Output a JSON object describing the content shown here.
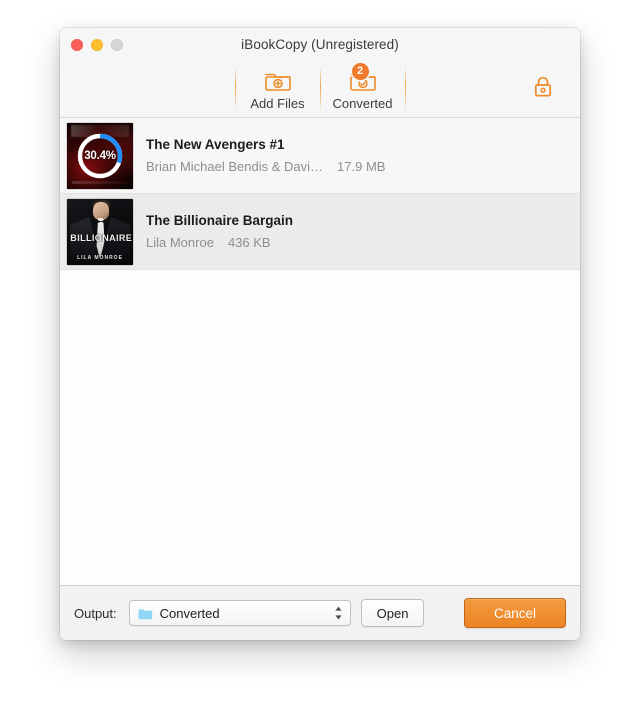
{
  "window": {
    "title": "iBookCopy (Unregistered)",
    "traffic_lights": [
      {
        "name": "close",
        "color": "#fb5f57"
      },
      {
        "name": "minimize",
        "color": "#fbbe2e"
      },
      {
        "name": "zoom",
        "color": "#d4d4d4"
      }
    ]
  },
  "toolbar": {
    "add_files_label": "Add Files",
    "converted_label": "Converted",
    "converted_badge": "2",
    "add_files_icon": "folder-plus-icon",
    "converted_icon": "folder-check-icon",
    "lock_icon": "padlock-icon",
    "accent_color": "#ef8b27"
  },
  "books": [
    {
      "title": "The New Avengers #1",
      "author": "Brian Michael Bendis & Davi…",
      "size": "17.9 MB",
      "progress_label": "30.4%",
      "progress_value": 30.4,
      "selected": false,
      "cover": "avengers-cover",
      "progress_track_color": "#ffffff",
      "progress_fill_color": "#1f8ffb"
    },
    {
      "title": "The Billionaire Bargain",
      "author": "Lila Monroe",
      "size": "436 KB",
      "progress_label": "",
      "progress_value": null,
      "selected": true,
      "cover": "billionaire-cover",
      "cover_text": {
        "title": "BILLIONAIRE",
        "author": "LILA MONROE"
      }
    }
  ],
  "bottom_bar": {
    "output_label": "Output:",
    "output_value": "Converted",
    "folder_icon": "folder-icon",
    "stepper_icon": "chevron-up-down-icon",
    "open_label": "Open",
    "cancel_label": "Cancel",
    "cancel_color": "#ef8b27"
  }
}
